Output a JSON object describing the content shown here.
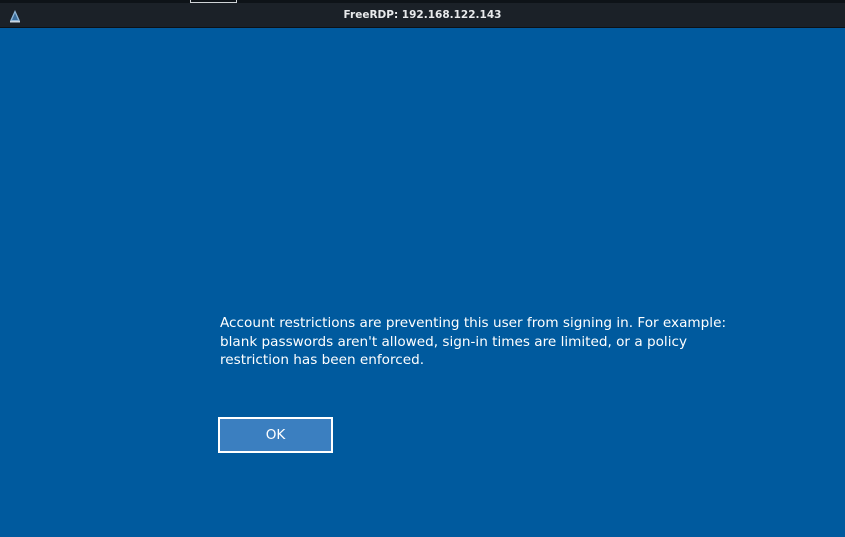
{
  "window": {
    "title": "FreeRDP: 192.168.122.143",
    "icon": "freerdp-app-icon"
  },
  "dialog": {
    "message": "Account restrictions are preventing this user from signing in. For example: blank passwords aren't allowed, sign-in times are limited, or a policy restriction has been enforced.",
    "ok_label": "OK"
  },
  "colors": {
    "background": "#005a9e",
    "titlebar": "#1b2128",
    "button_fill": "#3b7fc0",
    "text": "#ffffff"
  }
}
